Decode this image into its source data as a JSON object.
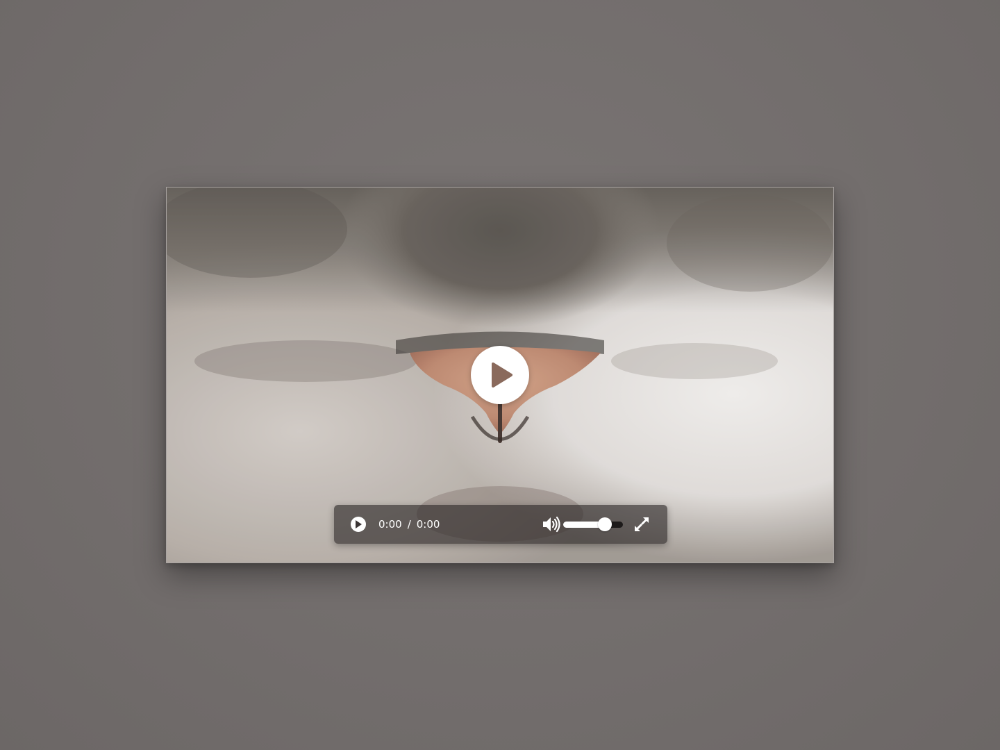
{
  "player": {
    "current_time": "0:00",
    "separator": "/",
    "duration": "0:00",
    "volume_level": 0.7,
    "icons": {
      "big_play": "play-circle-icon",
      "play": "play-icon",
      "volume": "volume-high-icon",
      "fullscreen": "expand-icon"
    },
    "colors": {
      "control_bar": "#282424",
      "icon": "#ffffff",
      "play_triangle": "#8a6a5c"
    }
  }
}
